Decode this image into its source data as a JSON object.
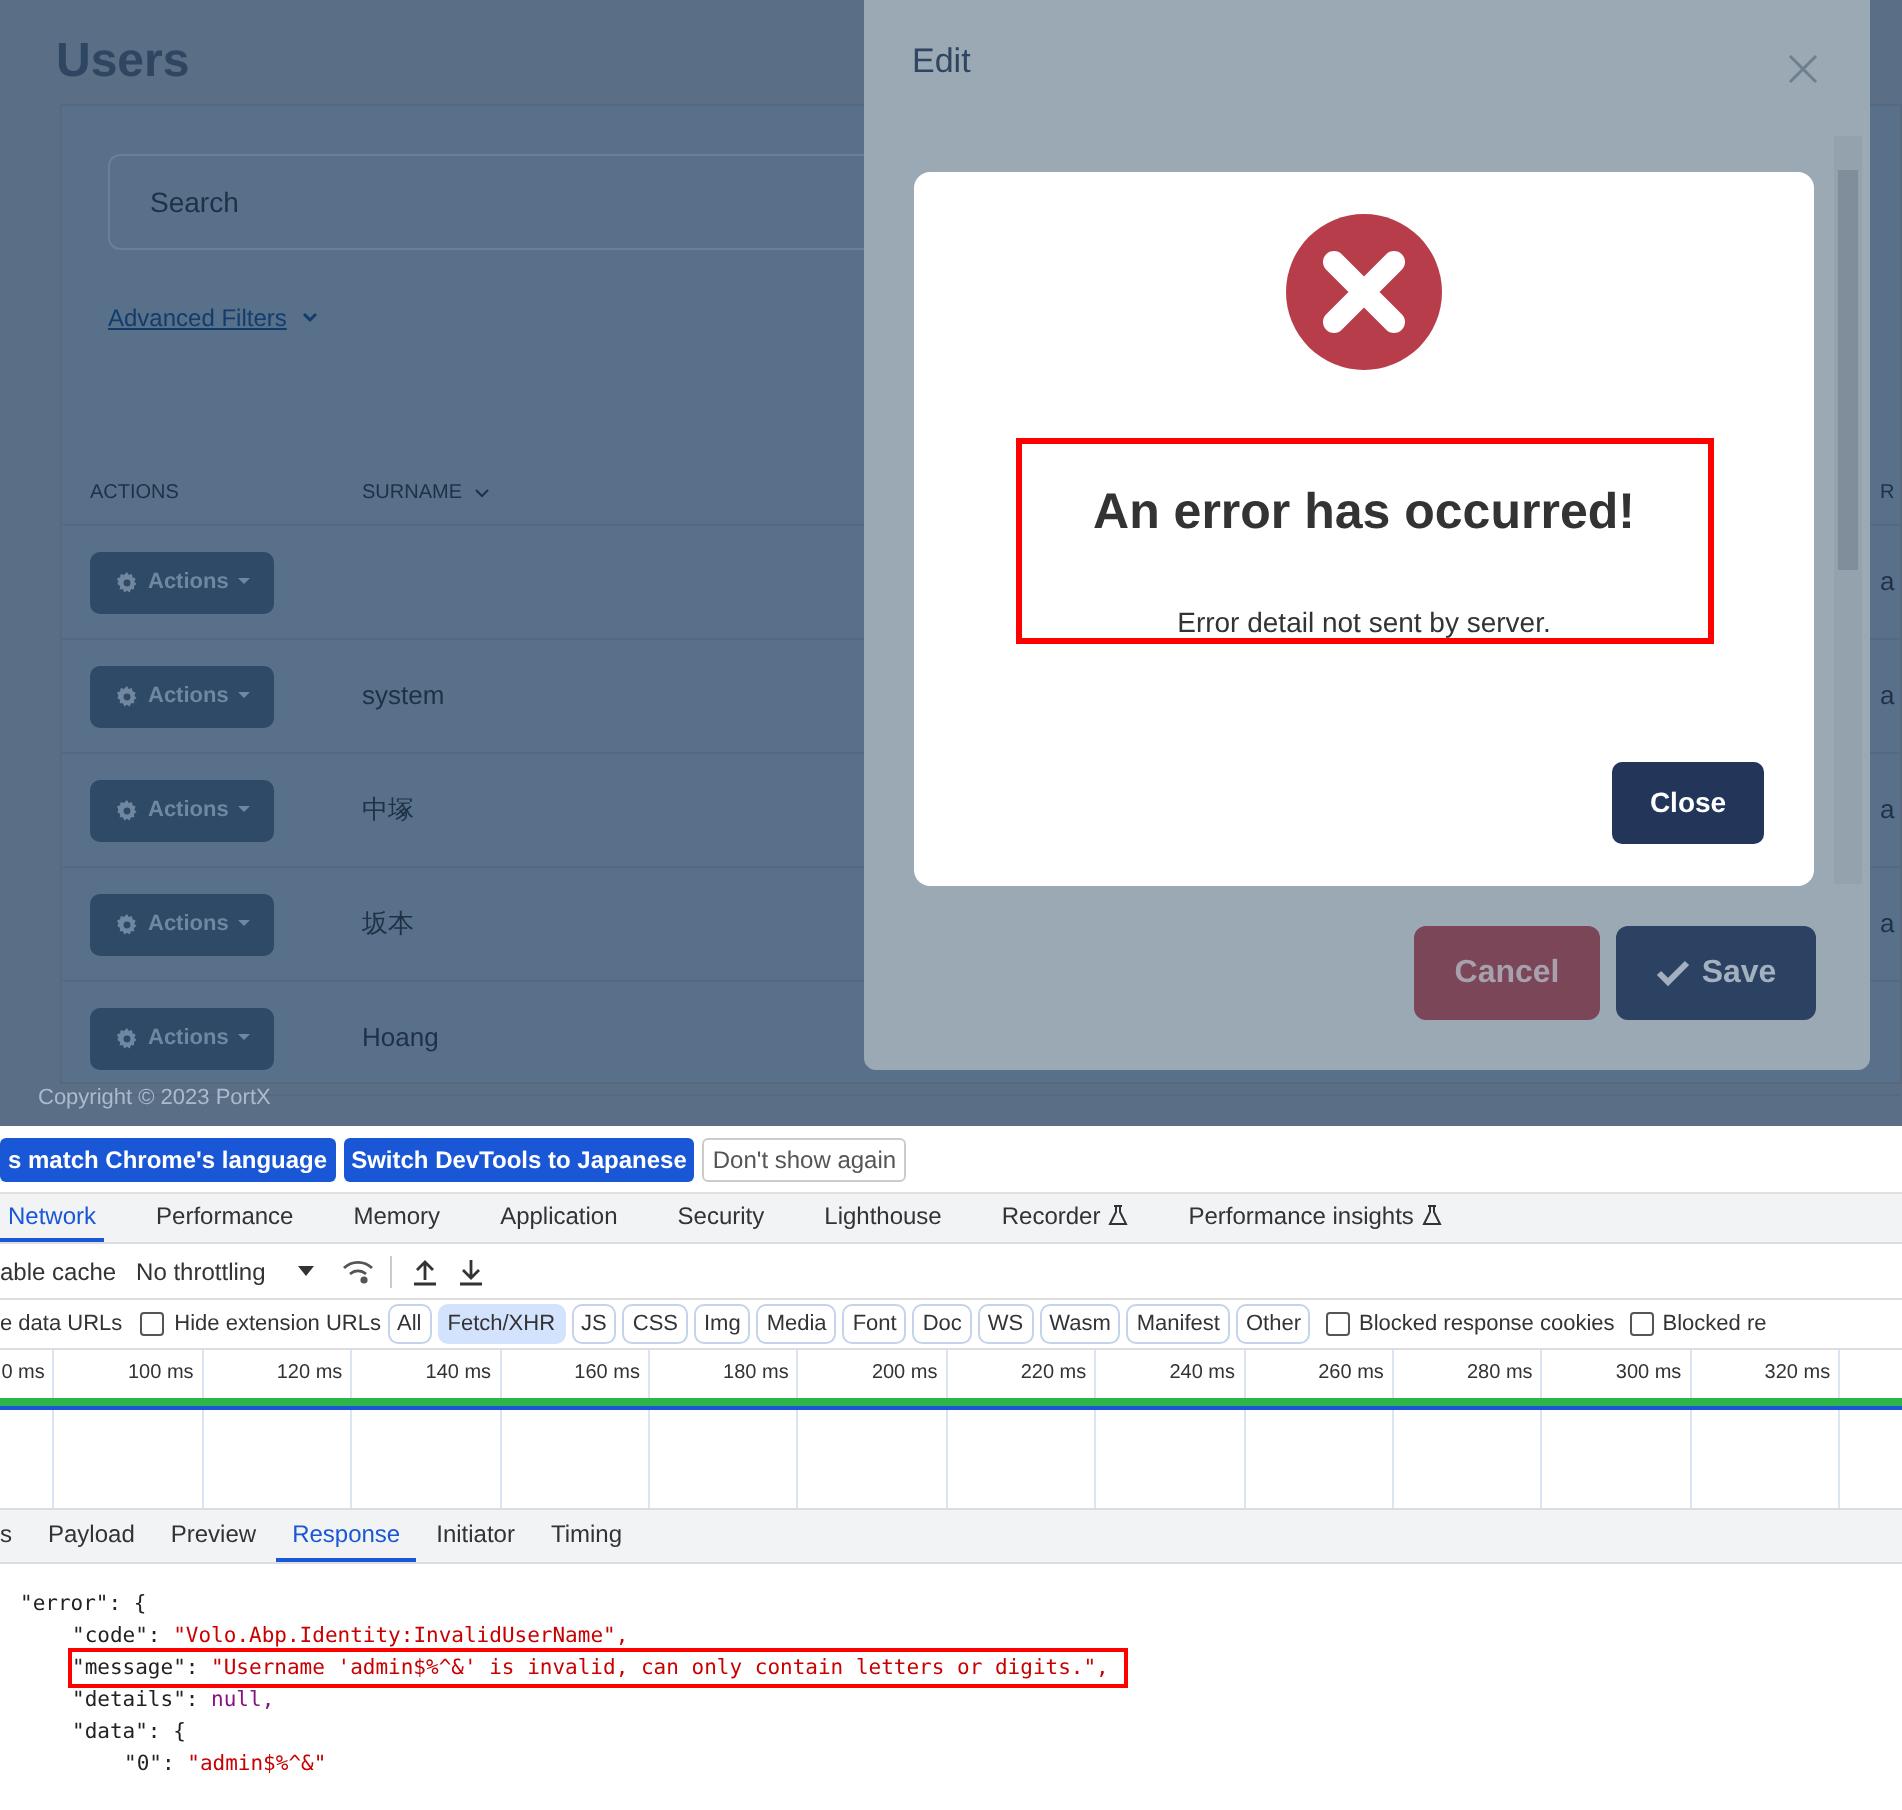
{
  "page": {
    "title": "Users",
    "search": {
      "placeholder": "Search"
    },
    "advanced_filters": "Advanced Filters",
    "footer": "Copyright © 2023 PortX"
  },
  "table": {
    "columns": [
      "ACTIONS",
      "SURNAME",
      "R"
    ],
    "rows": [
      {
        "actions": "Actions",
        "surname": "",
        "column_3": "a"
      },
      {
        "actions": "Actions",
        "surname": "system",
        "column_3": "a"
      },
      {
        "actions": "Actions",
        "surname": "中塚",
        "column_3": "a"
      },
      {
        "actions": "Actions",
        "surname": "坂本",
        "column_3": "a"
      },
      {
        "actions": "Actions",
        "surname": "Hoang",
        "column_3": ""
      }
    ]
  },
  "edit_modal": {
    "title": "Edit",
    "buttons": [
      {
        "kind": "cancel",
        "label": "Cancel"
      },
      {
        "kind": "save",
        "label": "Save"
      }
    ]
  },
  "error_dialog": {
    "title": "An error has occurred!",
    "detail": "Error detail not sent by server.",
    "highlighted": true,
    "button": "Close"
  },
  "devtools": {
    "language_bar": [
      {
        "kind": "primary",
        "label": "s match Chrome's language"
      },
      {
        "kind": "primary",
        "label": "Switch DevTools to Japanese"
      },
      {
        "kind": "plain",
        "label": "Don't show again"
      }
    ],
    "tabs": [
      {
        "label": "Network",
        "selected": true,
        "experimental": false
      },
      {
        "label": "Performance",
        "selected": false,
        "experimental": false
      },
      {
        "label": "Memory",
        "selected": false,
        "experimental": false
      },
      {
        "label": "Application",
        "selected": false,
        "experimental": false
      },
      {
        "label": "Security",
        "selected": false,
        "experimental": false
      },
      {
        "label": "Lighthouse",
        "selected": false,
        "experimental": false
      },
      {
        "label": "Recorder",
        "selected": false,
        "experimental": true
      },
      {
        "label": "Performance insights",
        "selected": false,
        "experimental": true
      }
    ],
    "toolbar": {
      "cache_label": "able cache",
      "throttling": "No throttling"
    },
    "filters": {
      "leading": "e data URLs",
      "hide_extension": {
        "label": "Hide extension URLs",
        "checked": false
      },
      "chips": [
        {
          "label": "All",
          "selected": false
        },
        {
          "label": "Fetch/XHR",
          "selected": true
        },
        {
          "label": "JS",
          "selected": false
        },
        {
          "label": "CSS",
          "selected": false
        },
        {
          "label": "Img",
          "selected": false
        },
        {
          "label": "Media",
          "selected": false
        },
        {
          "label": "Font",
          "selected": false
        },
        {
          "label": "Doc",
          "selected": false
        },
        {
          "label": "WS",
          "selected": false
        },
        {
          "label": "Wasm",
          "selected": false
        },
        {
          "label": "Manifest",
          "selected": false
        },
        {
          "label": "Other",
          "selected": false
        }
      ],
      "trailing": [
        {
          "label": "Blocked response cookies",
          "checked": false
        },
        {
          "label": "Blocked re",
          "checked": false
        }
      ]
    },
    "timeline_ticks": [
      "0 ms",
      "100 ms",
      "120 ms",
      "140 ms",
      "160 ms",
      "180 ms",
      "200 ms",
      "220 ms",
      "240 ms",
      "260 ms",
      "280 ms",
      "300 ms",
      "320 ms"
    ],
    "detail_tabs": [
      {
        "label": "s",
        "selected": false
      },
      {
        "label": "Payload",
        "selected": false
      },
      {
        "label": "Preview",
        "selected": false
      },
      {
        "label": "Response",
        "selected": true
      },
      {
        "label": "Initiator",
        "selected": false
      },
      {
        "label": "Timing",
        "selected": false
      }
    ],
    "response": [
      {
        "key": "\"error\":",
        "value": "{",
        "kind": "open",
        "highlighted": false,
        "children": [
          {
            "key": "\"code\":",
            "value": "\"Volo.Abp.Identity:InvalidUserName\",",
            "kind": "string",
            "highlighted": false
          },
          {
            "key": "\"message\":",
            "value": "\"Username 'admin$%^&' is invalid, can only contain letters or digits.\",",
            "kind": "string",
            "highlighted": true
          },
          {
            "key": "\"details\":",
            "value": "null,",
            "kind": "null",
            "highlighted": false
          },
          {
            "key": "\"data\":",
            "value": "{",
            "kind": "open",
            "highlighted": false,
            "children": [
              {
                "key": "\"0\":",
                "value": "\"admin$%^&\"",
                "kind": "string",
                "highlighted": false
              }
            ]
          }
        ]
      }
    ]
  }
}
